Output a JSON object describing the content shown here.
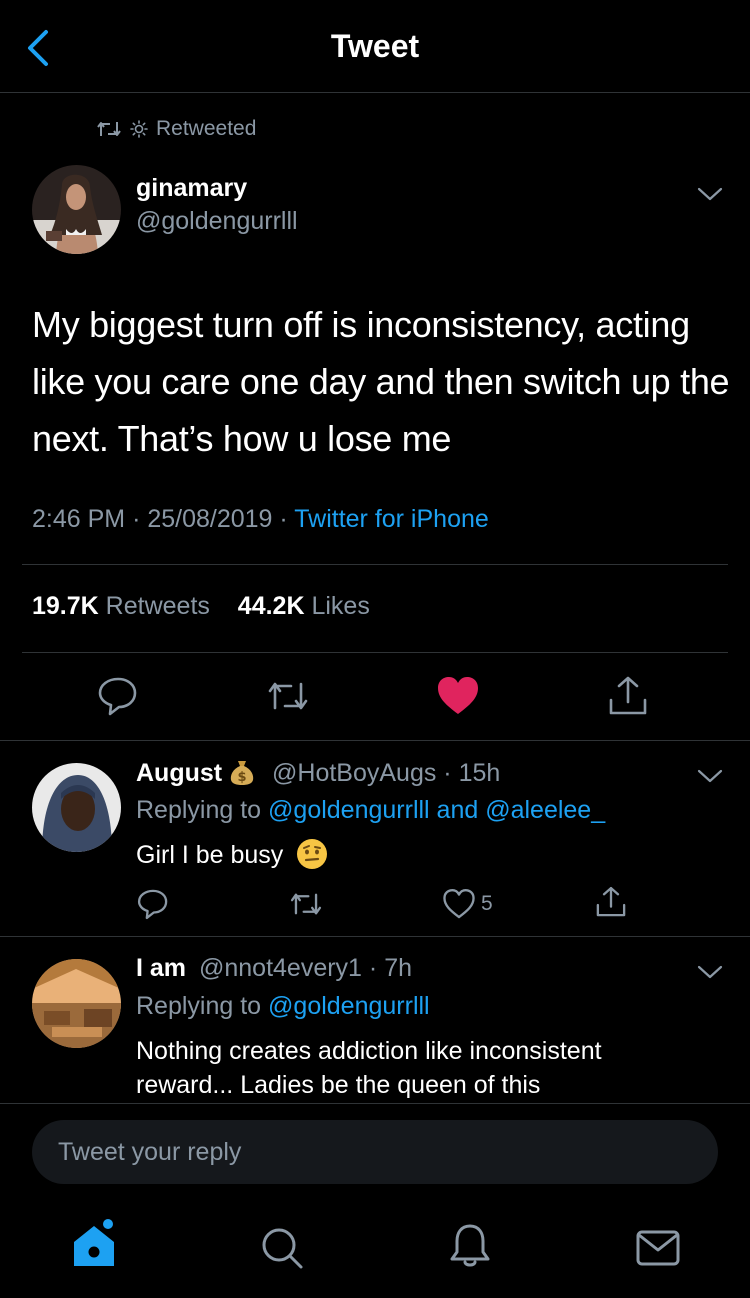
{
  "header": {
    "title": "Tweet"
  },
  "retweet_banner": {
    "label": "Retweeted"
  },
  "tweet": {
    "author_name": "ginamary",
    "author_handle": "@goldengurrlll",
    "text": "My biggest turn off is inconsistency, acting like you care one day and then switch up the next. That’s how u lose me",
    "time": "2:46 PM",
    "date": "25/08/2019",
    "source": "Twitter for iPhone",
    "retweets_count": "19.7K",
    "retweets_label": "Retweets",
    "likes_count": "44.2K",
    "likes_label": "Likes",
    "liked": true
  },
  "replies": [
    {
      "name": "August",
      "badge_icon": "money-bag-icon",
      "handle": "@HotBoyAugs",
      "time": "15h",
      "replying_label": "Replying to",
      "replying_targets": "@goldengurrlll and @aleelee_",
      "text": "Girl I be busy",
      "emoji_icon": "face-with-raised-eyebrow-icon",
      "like_count": "5"
    },
    {
      "name": "I am",
      "handle": "@nnot4every1",
      "time": "7h",
      "replying_label": "Replying to",
      "replying_targets": "@goldengurrlll",
      "text": "Nothing creates addiction like inconsistent reward... Ladies be the queen of this"
    }
  ],
  "compose": {
    "placeholder": "Tweet your reply"
  },
  "colors": {
    "accent": "#1da1f2",
    "like": "#e0245e",
    "background": "#000000",
    "secondary_text": "#8b98a5"
  },
  "tabbar": {
    "items": [
      "home-icon",
      "search-icon",
      "notifications-icon",
      "messages-icon"
    ]
  }
}
